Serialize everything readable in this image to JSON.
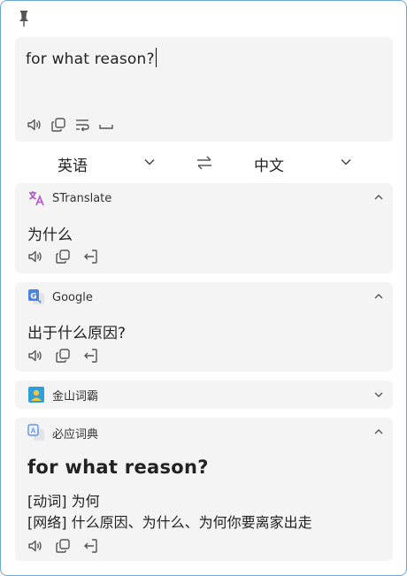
{
  "input": {
    "text": "for what reason?"
  },
  "languages": {
    "source": "英语",
    "target": "中文"
  },
  "services": [
    {
      "name": "STranslate",
      "result": "为什么"
    },
    {
      "name": "Google",
      "result": "出于什么原因?"
    },
    {
      "name": "金山词霸"
    },
    {
      "name": "必应词典",
      "headword": "for what reason?",
      "senses": [
        {
          "pos": "[动词]",
          "meaning": "为何"
        },
        {
          "pos": "[网络]",
          "meaning": "什么原因、为什么、为何你要离家出走"
        }
      ]
    }
  ],
  "colors": {
    "accent": "#6aa6dc",
    "stranslate_logo": "#b255c8",
    "google_logo": "#4a82e0",
    "kingsoft_logo": "#2d9fd9"
  }
}
